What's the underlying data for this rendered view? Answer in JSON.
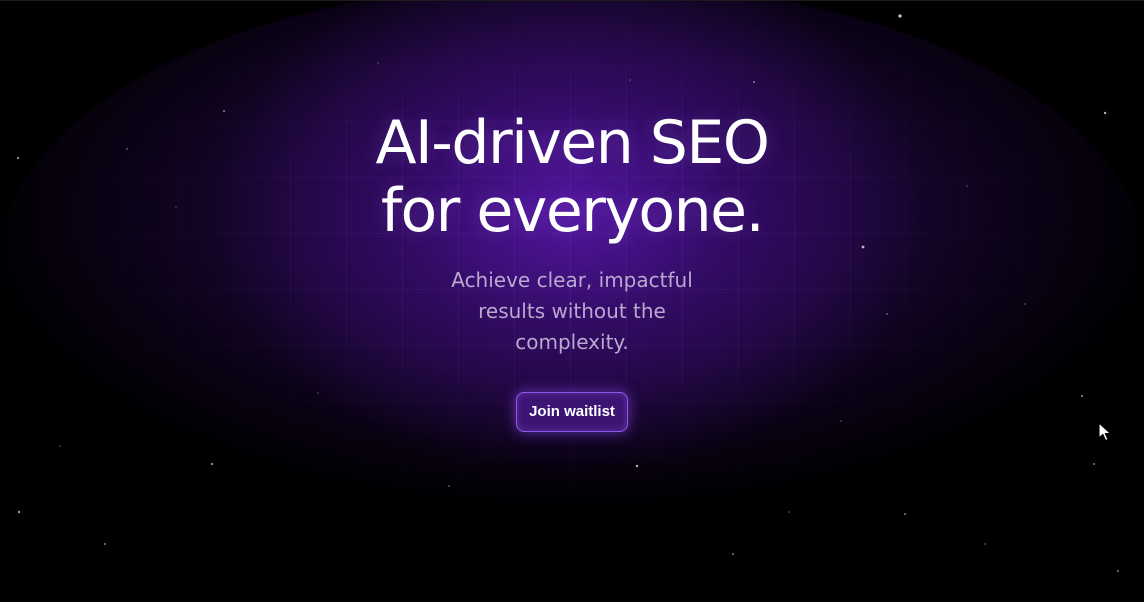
{
  "hero": {
    "headline": "AI-driven SEO for everyone.",
    "subtitle": "Achieve clear, impactful results without the complexity.",
    "cta_label": "Join waitlist"
  },
  "colors": {
    "background": "#000000",
    "glow": "#4a1590",
    "cta_background": "#3c1474",
    "cta_border": "#8e56e8",
    "subtitle": "#b9a9d1",
    "headline": "#ffffff"
  },
  "icons": {
    "cursor": "mouse-pointer-icon"
  }
}
